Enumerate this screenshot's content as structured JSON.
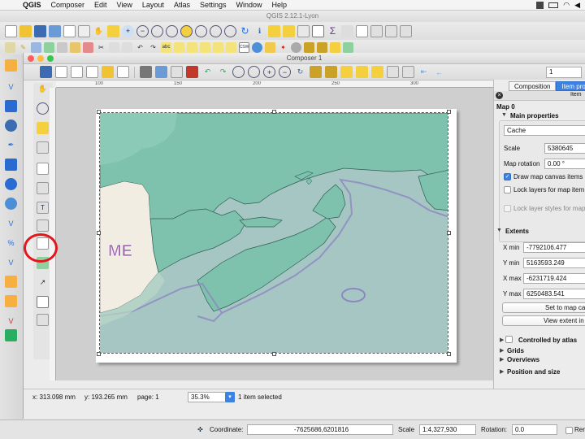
{
  "menubar": {
    "app": "QGIS",
    "items": [
      "Composer",
      "Edit",
      "View",
      "Layout",
      "Atlas",
      "Settings",
      "Window",
      "Help"
    ]
  },
  "qgis_title": "QGIS 2.12.1-Lyon",
  "composer": {
    "title": "Composer 1",
    "page_number": "1",
    "map_labels": {
      "state": "ME"
    }
  },
  "dock": {
    "tabs": [
      "Composition",
      "Item pro"
    ],
    "header": "Item",
    "item_name": "Map 0",
    "main_properties": {
      "title": "Main properties",
      "cache_value": "Cache",
      "scale_label": "Scale",
      "scale_value": "5380645",
      "rotation_label": "Map rotation",
      "rotation_value": "0.00 °",
      "draw_canvas_label": "Draw map canvas items",
      "lock_layers_label": "Lock layers for map item",
      "lock_styles_label": "Lock layer styles for map"
    },
    "extents": {
      "title": "Extents",
      "xmin_label": "X min",
      "xmin_value": "-7792106.477",
      "ymin_label": "Y min",
      "ymin_value": "5163593.249",
      "xmax_label": "X max",
      "xmax_value": "-6231719.424",
      "ymax_label": "Y max",
      "ymax_value": "6250483.541",
      "set_to_map_label": "Set to map ca",
      "view_extent_label": "View extent in"
    },
    "sections": {
      "atlas": "Controlled by atlas",
      "grids": "Grids",
      "overviews": "Overviews",
      "position": "Position and size"
    }
  },
  "composer_status": {
    "x": "x: 313.098 mm",
    "y": "y: 193.265 mm",
    "page": "page: 1",
    "zoom": "35.3%",
    "selected": "1 item selected"
  },
  "qgis_status": {
    "coordinate_label": "Coordinate:",
    "coordinate_value": "-7625686,6201816",
    "scale_label": "Scale",
    "scale_value": "1:4,327,930",
    "rotation_label": "Rotation:",
    "rotation_value": "0.0",
    "render_label": "Ren"
  },
  "ruler_ticks": [
    "100",
    "150",
    "200",
    "250",
    "300"
  ],
  "colors": {
    "accent": "#3b82e4",
    "land": "#7ec2ad",
    "water": "#a5c6c3",
    "us_land": "#f1ede2",
    "highlight": "#e3161b"
  }
}
